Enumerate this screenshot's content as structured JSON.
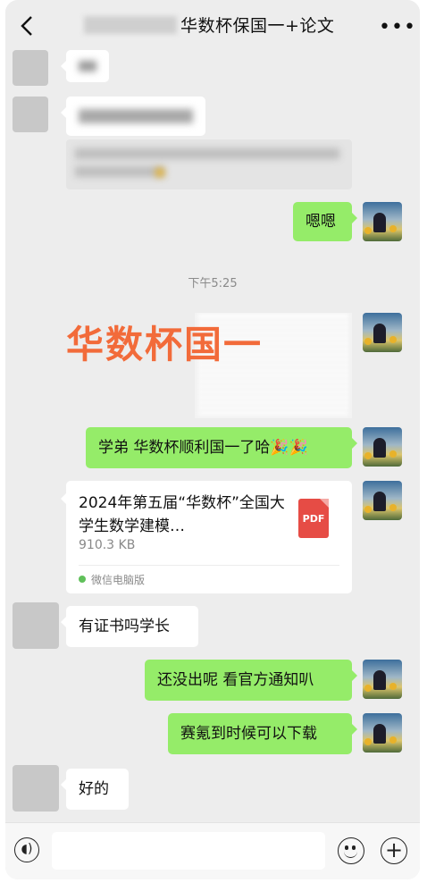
{
  "header": {
    "title": "华数杯保国一+论文",
    "more_icon": "more-icon",
    "back_icon": "back-arrow-icon"
  },
  "messages": {
    "m4_text": "嗯嗯",
    "time": "下午5:25",
    "image_overlay": "华数杯国一",
    "m6_text": "学弟 华数杯顺利国一了哈🎉🎉",
    "file": {
      "title": "2024年第五届“华数杯”全国大学生数学建模…",
      "size": "910.3 KB",
      "source": "微信电脑版",
      "icon_label": "PDF"
    },
    "m8_text": "有证书吗学长",
    "m9_text": "还没出呢 看官方通知叭",
    "m10_text": "赛氪到时候可以下载",
    "m11_text": "好的"
  },
  "colors": {
    "right_bubble": "#95ec69",
    "left_bubble": "#ffffff",
    "background": "#ededed",
    "overlay": "#f26b3a"
  }
}
